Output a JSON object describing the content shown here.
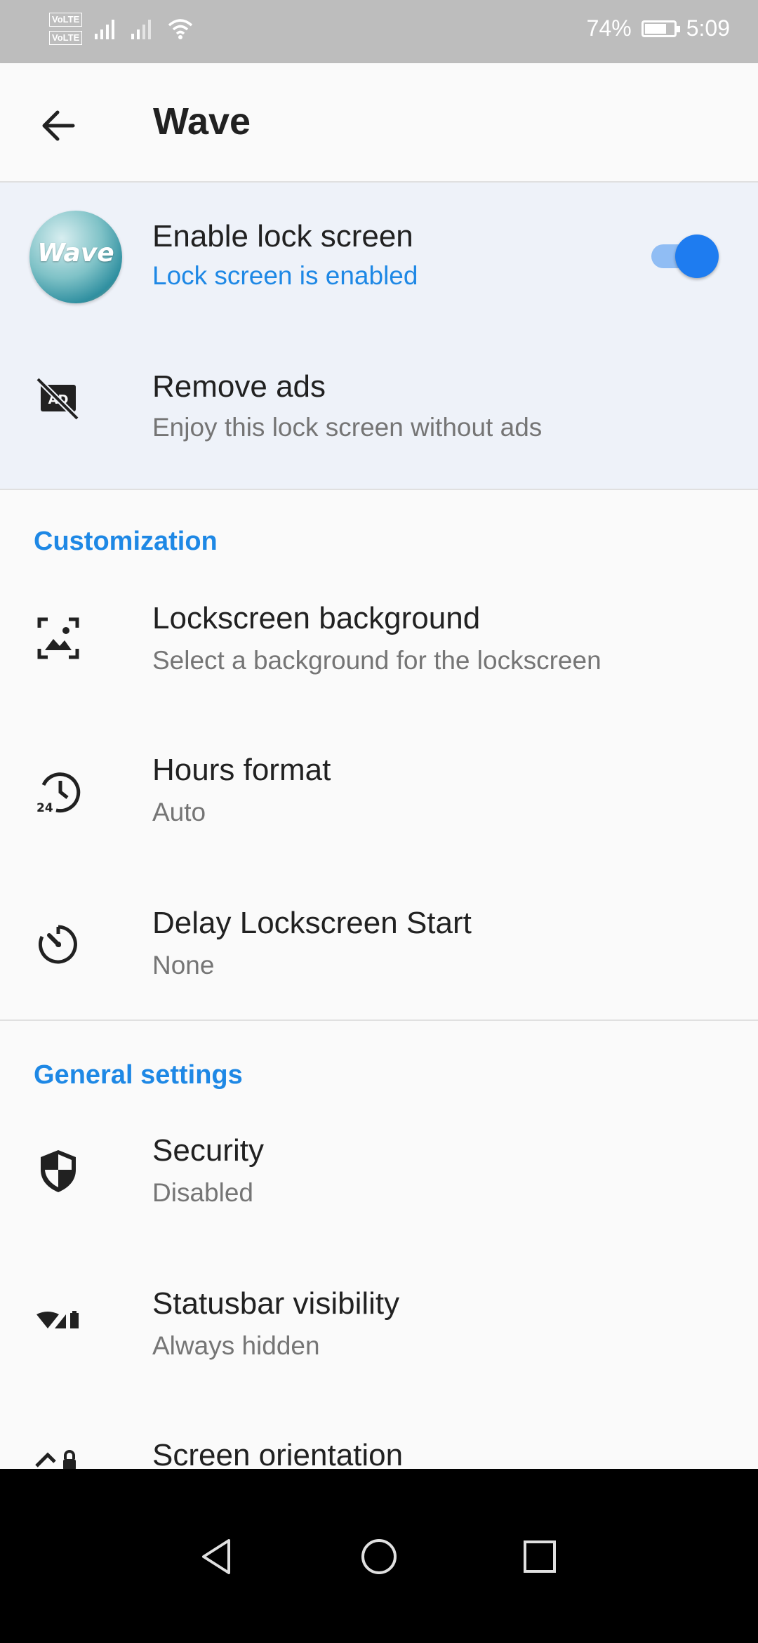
{
  "status_bar": {
    "volte_1": "VoLTE",
    "volte_2": "VoLTE",
    "battery_percent": "74%",
    "battery_level": 0.74,
    "time": "5:09"
  },
  "app_bar": {
    "title": "Wave",
    "back_icon": "arrow-back-icon"
  },
  "top_rows": [
    {
      "title": "Enable lock screen",
      "subtitle": "Lock screen is enabled",
      "avatar_text": "Wave",
      "toggle_on": true
    },
    {
      "title": "Remove ads",
      "subtitle": "Enjoy this lock screen without ads",
      "icon": "ads-off-icon"
    }
  ],
  "sections": [
    {
      "header": "Customization",
      "items": [
        {
          "title": "Lockscreen background",
          "subtitle": "Select a background for the lockscreen",
          "icon": "wallpaper-icon"
        },
        {
          "title": "Hours format",
          "subtitle": "Auto",
          "icon": "clock-24-icon"
        },
        {
          "title": "Delay Lockscreen Start",
          "subtitle": "None",
          "icon": "timer-icon"
        }
      ]
    },
    {
      "header": "General settings",
      "items": [
        {
          "title": "Security",
          "subtitle": "Disabled",
          "icon": "shield-icon"
        },
        {
          "title": "Statusbar visibility",
          "subtitle": "Always hidden",
          "icon": "signal-battery-icon"
        },
        {
          "title": "Screen orientation",
          "subtitle": "",
          "icon": "screen-rotation-lock-icon"
        }
      ]
    }
  ],
  "colors": {
    "accent": "#1e88e5",
    "toggle_thumb": "#1e7cf0",
    "highlight_bg": "#eef2f9",
    "status_bar_bg": "#bdbdbd"
  },
  "nav_bar": {
    "buttons": [
      "back-triangle-icon",
      "home-circle-icon",
      "recents-square-icon"
    ]
  }
}
